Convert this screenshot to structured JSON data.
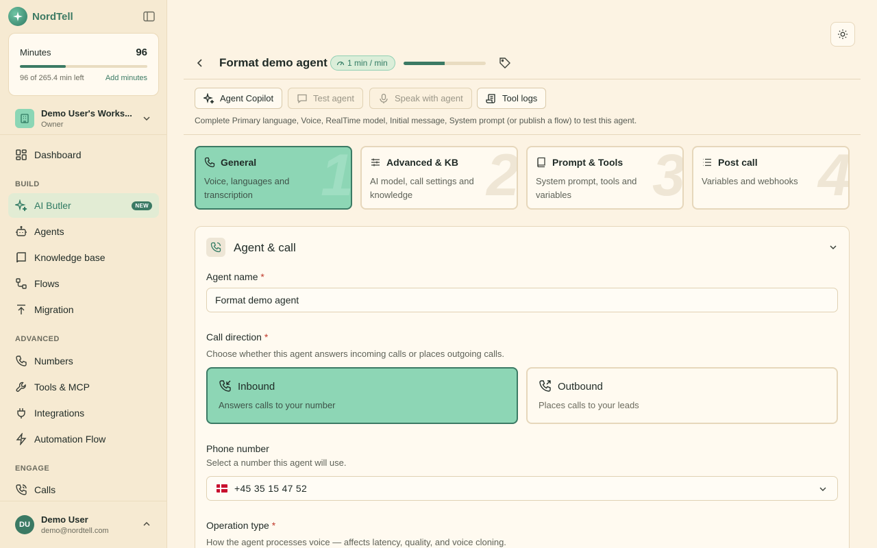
{
  "brand": {
    "name": "NordTell"
  },
  "minutes": {
    "label": "Minutes",
    "value": "96",
    "left_text": "96 of 265.4 min left",
    "add_label": "Add minutes",
    "fraction_used": 0.362
  },
  "workspace": {
    "name": "Demo User's Works...",
    "role": "Owner"
  },
  "nav": {
    "dashboard": "Dashboard",
    "build_header": "BUILD",
    "ai_butler": "AI Butler",
    "new_badge": "NEW",
    "agents": "Agents",
    "knowledge_base": "Knowledge base",
    "flows": "Flows",
    "migration": "Migration",
    "advanced_header": "ADVANCED",
    "numbers": "Numbers",
    "tools_mcp": "Tools & MCP",
    "integrations": "Integrations",
    "automation_flow": "Automation Flow",
    "engage_header": "ENGAGE",
    "calls": "Calls"
  },
  "user": {
    "initials": "DU",
    "name": "Demo User",
    "email": "demo@nordtell.com"
  },
  "header": {
    "agent_title": "Format demo agent",
    "rate_label": "1 min / min",
    "rate_fraction": 0.5
  },
  "toolbar": {
    "copilot": "Agent Copilot",
    "test_agent": "Test agent",
    "speak": "Speak with agent",
    "tool_logs": "Tool logs",
    "hint": "Complete Primary language, Voice, RealTime model, Initial message, System prompt (or publish a flow) to test this agent."
  },
  "steps": [
    {
      "num": "1",
      "title": "General",
      "desc": "Voice, languages and transcription"
    },
    {
      "num": "2",
      "title": "Advanced & KB",
      "desc": "AI model, call settings and knowledge"
    },
    {
      "num": "3",
      "title": "Prompt & Tools",
      "desc": "System prompt, tools and variables"
    },
    {
      "num": "4",
      "title": "Post call",
      "desc": "Variables and webhooks"
    }
  ],
  "panel": {
    "title": "Agent & call",
    "agent_name_label": "Agent name",
    "required_mark": "*",
    "agent_name_value": "Format demo agent",
    "call_direction_label": "Call direction",
    "call_direction_desc": "Choose whether this agent answers incoming calls or places outgoing calls.",
    "inbound_title": "Inbound",
    "inbound_desc": "Answers calls to your number",
    "outbound_title": "Outbound",
    "outbound_desc": "Places calls to your leads",
    "phone_label": "Phone number",
    "phone_desc": "Select a number this agent will use.",
    "phone_value": "+45 35 15 47 52",
    "operation_label": "Operation type",
    "operation_desc": "How the agent processes voice — affects latency, quality, and voice cloning."
  },
  "colors": {
    "accent": "#3b7a64",
    "accent_light": "#8dd6b5",
    "background": "#fcf3e3",
    "sidebar": "#f6ead2"
  }
}
